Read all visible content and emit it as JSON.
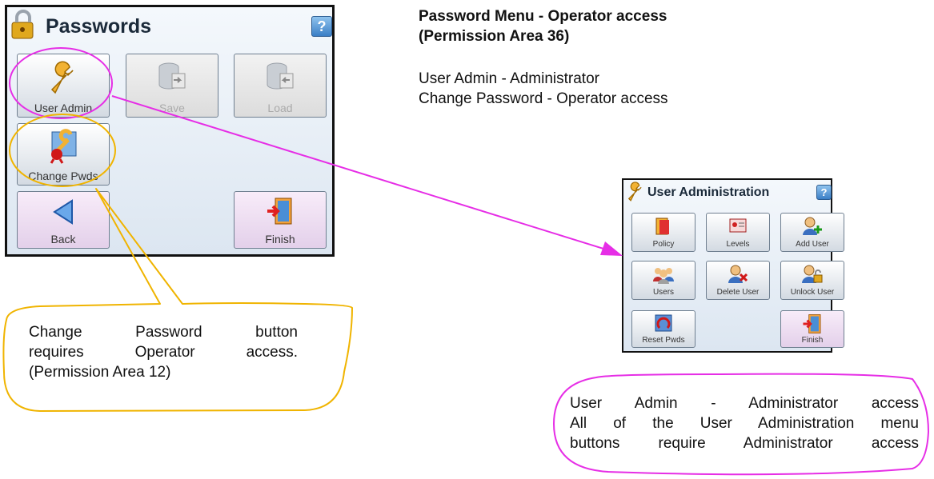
{
  "passwords_screen": {
    "title": "Passwords",
    "help": "?",
    "buttons": {
      "user_admin": "User Admin",
      "save": "Save",
      "load": "Load",
      "change_pwds": "Change Pwds",
      "back": "Back",
      "finish": "Finish"
    }
  },
  "right_info": {
    "heading_line1": "Password Menu - Operator access",
    "heading_line2": "(Permission Area 36)",
    "line1": "User Admin - Administrator",
    "line2": "Change Password - Operator access"
  },
  "user_admin_screen": {
    "title": "User Administration",
    "help": "?",
    "buttons": {
      "policy": "Policy",
      "levels": "Levels",
      "add_user": "Add User",
      "users": "Users",
      "delete_user": "Delete User",
      "unlock_user": "Unlock User",
      "reset_pwds": "Reset Pwds",
      "finish": "Finish"
    }
  },
  "callout_left": {
    "line1": "Change Password button",
    "line2": "requires Operator access.",
    "line3": "(Permission Area 12)"
  },
  "callout_right": {
    "line1": "User Admin - Administrator access",
    "line2": "All of the User Administration menu",
    "line3": "buttons require Administrator access"
  },
  "colors": {
    "highlight_pink": "#e62ee6",
    "highlight_orange": "#f0b400"
  }
}
